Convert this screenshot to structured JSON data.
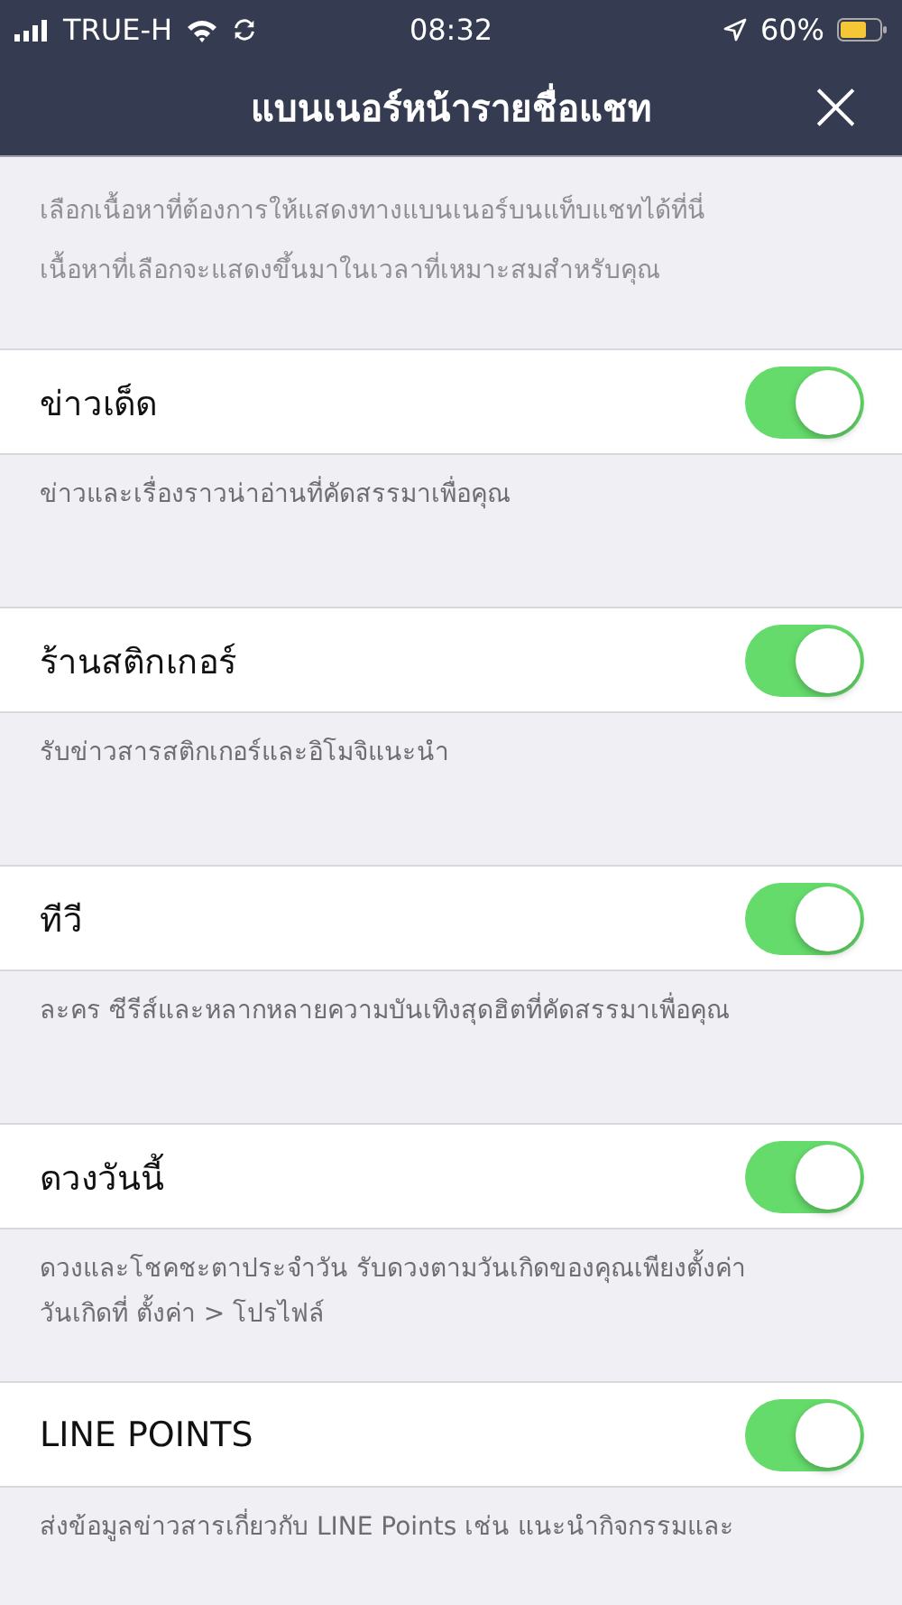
{
  "status_bar": {
    "carrier": "TRUE-H",
    "time": "08:32",
    "battery": "60%"
  },
  "header": {
    "title": "แบนเนอร์หน้ารายชื่อแชท",
    "close": "×"
  },
  "intro": [
    "เลือกเนื้อหาที่ต้องการให้แสดงทางแบนเนอร์บนแท็บแชทได้ที่นี่",
    "เนื้อหาที่เลือกจะแสดงขึ้นมาในเวลาที่เหมาะสมสำหรับคุณ"
  ],
  "settings": [
    {
      "label": "ข่าวเด็ด",
      "on": true,
      "description": [
        "ข่าวและเรื่องราวน่าอ่านที่คัดสรรมาเพื่อคุณ"
      ]
    },
    {
      "label": "ร้านสติกเกอร์",
      "on": true,
      "description": [
        "รับข่าวสารสติกเกอร์และอิโมจิแนะนำ"
      ]
    },
    {
      "label": "ทีวี",
      "on": true,
      "description": [
        "ละคร ซีรีส์และหลากหลายความบันเทิงสุดฮิตที่คัดสรรมาเพื่อคุณ"
      ]
    },
    {
      "label": "ดวงวันนี้",
      "on": true,
      "description": [
        "ดวงและโชคชะตาประจำวัน รับดวงตามวันเกิดของคุณเพียงตั้งค่า",
        "วันเกิดที่ ตั้งค่า > โปรไฟล์"
      ]
    },
    {
      "label": "LINE POINTS",
      "on": true,
      "description": [
        "ส่งข้อมูลข่าวสารเกี่ยวกับ LINE Points เช่น แนะนำกิจกรรมและ"
      ]
    }
  ]
}
